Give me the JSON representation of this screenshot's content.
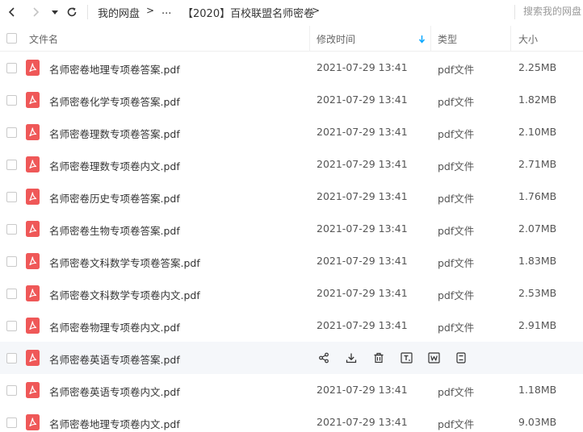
{
  "nav": {
    "breadcrumb": [
      {
        "label": "我的网盘"
      },
      {
        "label": "..."
      },
      {
        "label": "【2020】百校联盟名师密卷"
      }
    ],
    "arrow": ">",
    "search_placeholder": "搜索我的网盘"
  },
  "columns": {
    "name": "文件名",
    "modified": "修改时间",
    "type": "类型",
    "size": "大小"
  },
  "files": [
    {
      "name": "名师密卷地理专项卷答案.pdf",
      "modified": "2021-07-29 13:41",
      "type": "pdf文件",
      "size": "2.25MB"
    },
    {
      "name": "名师密卷化学专项卷答案.pdf",
      "modified": "2021-07-29 13:41",
      "type": "pdf文件",
      "size": "1.82MB"
    },
    {
      "name": "名师密卷理数专项卷答案.pdf",
      "modified": "2021-07-29 13:41",
      "type": "pdf文件",
      "size": "2.10MB"
    },
    {
      "name": "名师密卷理数专项卷内文.pdf",
      "modified": "2021-07-29 13:41",
      "type": "pdf文件",
      "size": "2.71MB"
    },
    {
      "name": "名师密卷历史专项卷答案.pdf",
      "modified": "2021-07-29 13:41",
      "type": "pdf文件",
      "size": "1.76MB"
    },
    {
      "name": "名师密卷生物专项卷答案.pdf",
      "modified": "2021-07-29 13:41",
      "type": "pdf文件",
      "size": "2.07MB"
    },
    {
      "name": "名师密卷文科数学专项卷答案.pdf",
      "modified": "2021-07-29 13:41",
      "type": "pdf文件",
      "size": "1.83MB"
    },
    {
      "name": "名师密卷文科数学专项卷内文.pdf",
      "modified": "2021-07-29 13:41",
      "type": "pdf文件",
      "size": "2.53MB"
    },
    {
      "name": "名师密卷物理专项卷内文.pdf",
      "modified": "2021-07-29 13:41",
      "type": "pdf文件",
      "size": "2.91MB"
    },
    {
      "name": "名师密卷英语专项卷答案.pdf",
      "hovered": true
    },
    {
      "name": "名师密卷英语专项卷内文.pdf",
      "modified": "2021-07-29 13:41",
      "type": "pdf文件",
      "size": "1.18MB"
    },
    {
      "name": "名师密卷地理专项卷内文.pdf",
      "modified": "2021-07-29 13:41",
      "type": "pdf文件",
      "size": "9.03MB"
    }
  ],
  "hover_actions": [
    "share-icon",
    "download-icon",
    "delete-icon",
    "text-extract-icon",
    "word-convert-icon",
    "print-icon"
  ],
  "colors": {
    "pdf_icon": "#ef5858",
    "sort_arrow": "#06a7ff",
    "hover_row": "#f5f7fa"
  }
}
